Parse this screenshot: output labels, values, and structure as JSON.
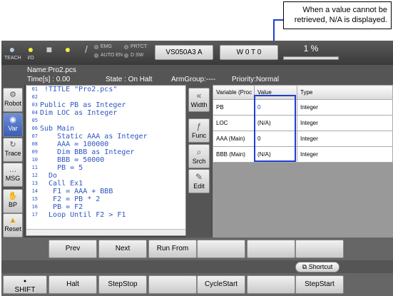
{
  "annotation": {
    "line1": "When a value cannot be",
    "line2": "retrieved, N/A is displayed."
  },
  "topbar": {
    "teach_label": "TEACH",
    "io_label": "I/O",
    "lamps": [
      "EMG",
      "PRTCT",
      "AUTO EN",
      "D SW"
    ],
    "controller": "VS050A3 A",
    "mode_value": "W 0 T 0",
    "percent": "1 %"
  },
  "info": {
    "name": "Name:Pro2.pcs",
    "time": "Time[s] : 0.00",
    "state": "State : On Halt",
    "armgroup": "ArmGroup:----",
    "priority": "Priority:Normal"
  },
  "left_buttons": [
    {
      "label": "Robot",
      "icon": "robot-icon"
    },
    {
      "label": "Var",
      "icon": "variable-icon"
    },
    {
      "label": "Trace",
      "icon": "trace-icon"
    },
    {
      "label": "MSG",
      "icon": "message-icon"
    },
    {
      "label": "BP",
      "icon": "hand-icon"
    },
    {
      "label": "Reset",
      "icon": "warning-icon"
    }
  ],
  "code": [
    {
      "n": "01",
      "t": " !TITLE \"Pro2.pcs\""
    },
    {
      "n": "02",
      "t": ""
    },
    {
      "n": "03",
      "t": "Public PB as Integer"
    },
    {
      "n": "04",
      "t": "Dim LOC as Integer"
    },
    {
      "n": "05",
      "t": ""
    },
    {
      "n": "06",
      "t": "Sub Main"
    },
    {
      "n": "07",
      "t": "    Static AAA as Integer"
    },
    {
      "n": "08",
      "t": "    AAA = 100000"
    },
    {
      "n": "09",
      "t": "    Dim BBB as Integer"
    },
    {
      "n": "10",
      "t": "    BBB = 50000"
    },
    {
      "n": "11",
      "t": "    PB = 5"
    },
    {
      "n": "12",
      "t": "  Do"
    },
    {
      "n": "13",
      "t": "  Call Ex1"
    },
    {
      "n": "14",
      "t": "   F1 = AAA + BBB"
    },
    {
      "n": "15",
      "t": "   F2 = PB * 2"
    },
    {
      "n": "16",
      "t": "   PB = F2"
    },
    {
      "n": "17",
      "t": "  Loop Until F2 > F1"
    }
  ],
  "mid_buttons": [
    {
      "label": "Width",
      "icon": "double-chevron-left-icon"
    },
    {
      "label": "Func",
      "icon": "function-icon"
    },
    {
      "label": "Srch",
      "icon": "search-icon"
    },
    {
      "label": "Edit",
      "icon": "pencil-icon"
    }
  ],
  "var_table": {
    "headers": [
      "Variable (Proc",
      "Value",
      "Type"
    ],
    "rows": [
      [
        "PB",
        "0",
        "Integer"
      ],
      [
        "LOC",
        "(N/A)",
        "Integer"
      ],
      [
        "AAA (Main)",
        "0",
        "Integer"
      ],
      [
        "BBB (Main)",
        "(N/A)",
        "Integer"
      ]
    ]
  },
  "bottom_row1": [
    "Prev",
    "Next",
    "Run From",
    "",
    "",
    ""
  ],
  "shortcut_label": "Shortcut",
  "bottom_row2": [
    "SHIFT",
    "Halt",
    "StepStop",
    "",
    "CycleStart",
    "",
    "StepStart"
  ]
}
